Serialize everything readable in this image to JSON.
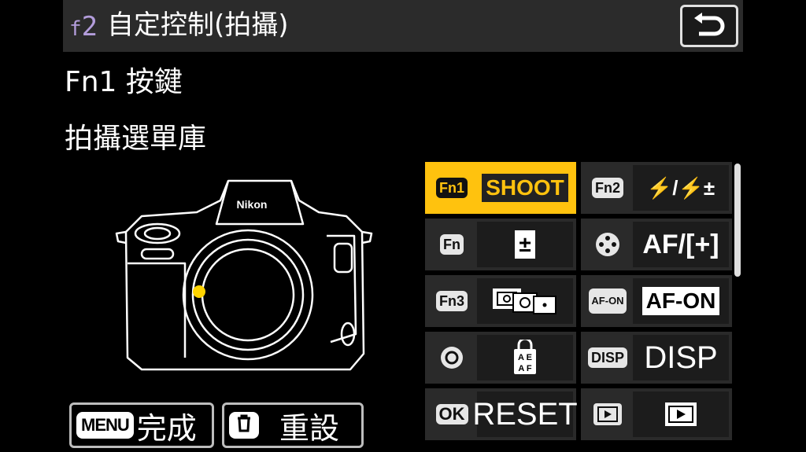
{
  "header": {
    "code_prefix": "f",
    "code_number": "2",
    "title": "自定控制(拍攝)"
  },
  "subtitle": {
    "line1": "Fn1 按鍵",
    "line2": "拍攝選單庫"
  },
  "camera": {
    "brand": "Nikon"
  },
  "footer": {
    "done_key": "MENU",
    "done_label": "完成",
    "reset_label": "重設"
  },
  "grid": {
    "cells": [
      {
        "button": "Fn1",
        "function": "SHOOT",
        "selected": true
      },
      {
        "button": "Fn2",
        "function": "⚡/⚡±"
      },
      {
        "button": "Fn",
        "function": "±"
      },
      {
        "button": "",
        "function": "AF/[+]"
      },
      {
        "button": "Fn3",
        "function": ""
      },
      {
        "button": "AF-ON",
        "function": "AF-ON"
      },
      {
        "button": "",
        "function": ""
      },
      {
        "button": "DISP",
        "function": "DISP"
      },
      {
        "button": "OK",
        "function": "RESET"
      },
      {
        "button": "",
        "function": ""
      }
    ]
  },
  "colors": {
    "accent": "#ffc20e",
    "code": "#b39ddb"
  }
}
